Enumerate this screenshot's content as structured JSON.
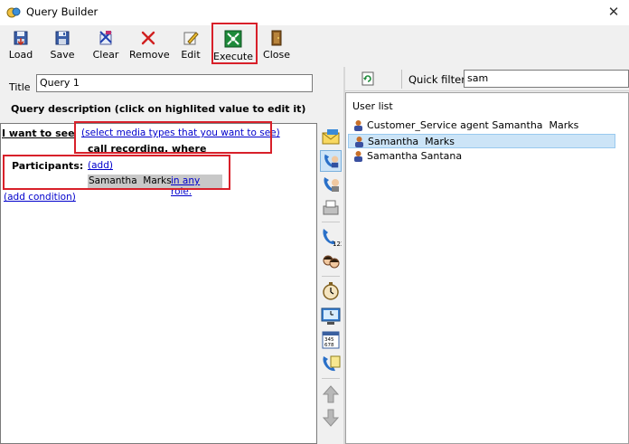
{
  "window": {
    "title": "Query Builder",
    "close_glyph": "✕"
  },
  "toolbar": {
    "buttons": [
      {
        "label": "Load",
        "icon": "load-icon"
      },
      {
        "label": "Save",
        "icon": "save-icon"
      },
      {
        "label": "Clear",
        "icon": "clear-icon"
      },
      {
        "label": "Remove",
        "icon": "remove-icon"
      },
      {
        "label": "Edit",
        "icon": "edit-icon"
      },
      {
        "label": "Execute",
        "icon": "execute-icon"
      },
      {
        "label": "Close",
        "icon": "door-icon"
      }
    ]
  },
  "query": {
    "title_label": "Title",
    "title_value": "Query 1",
    "description_heading": "Query description (click on highlited value to edit it)",
    "i_want_to_see": "I want to see",
    "media_types_link": "(select media types that you want to see)",
    "call_recording_where": "call recording, where",
    "participants_label": "Participants:",
    "add_link": "(add)",
    "participant_name": "Samantha  Marks",
    "in_any_role": "in any role.",
    "add_condition": "(add condition)"
  },
  "filter": {
    "label": "Quick filter",
    "value": "sam"
  },
  "user_list": {
    "header": "User list",
    "items": [
      {
        "name": "Customer_Service agent Samantha  Marks",
        "selected": false
      },
      {
        "name": "Samantha  Marks",
        "selected": true
      },
      {
        "name": "Samantha Santana",
        "selected": false
      }
    ]
  },
  "colors": {
    "highlight_red": "#d8202a",
    "link_blue": "#0000cc",
    "selection": "#cce4f7"
  }
}
